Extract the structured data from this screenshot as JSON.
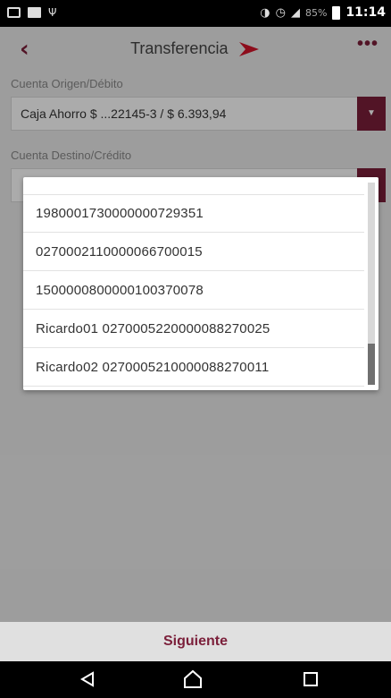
{
  "status_bar": {
    "battery": "85%",
    "time": "11:14"
  },
  "header": {
    "title": "Transferencia",
    "back_icon": "chevron-left-icon",
    "more_icon": "more-dots-icon",
    "more_label": "•••",
    "brand_color": "#7b1f3a"
  },
  "origin": {
    "label": "Cuenta Origen/Débito",
    "value": "Caja Ahorro $ ...22145-3 / $ 6.393,94"
  },
  "destination": {
    "label": "Cuenta Destino/Crédito"
  },
  "dropdown_options": [
    "1980001730000000729351",
    "0270002110000066700015",
    "1500000800000100370078",
    "Ricardo01 0270005220000088270025",
    "Ricardo02 0270005210000088270011"
  ],
  "footer": {
    "next_label": "Siguiente"
  }
}
